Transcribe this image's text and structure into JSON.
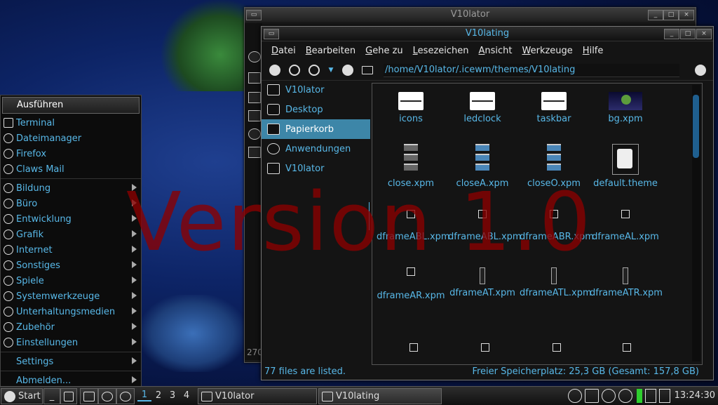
{
  "watermark": "Version 1.0",
  "back_window": {
    "title": "V10lator",
    "count_text": "270"
  },
  "window": {
    "title": "V10lating",
    "menu": [
      "Datei",
      "Bearbeiten",
      "Gehe zu",
      "Lesezeichen",
      "Ansicht",
      "Werkzeuge",
      "Hilfe"
    ],
    "toolbar": {
      "icons": [
        "back-icon",
        "forward-icon",
        "history-dropdown-icon",
        "up-icon",
        "home-folder-icon",
        "reload-icon"
      ],
      "path": "/home/V10lator/.icewm/themes/V10lating"
    },
    "sidebar": [
      {
        "label": "V10lator",
        "icon": "home-folder-icon",
        "selected": false
      },
      {
        "label": "Desktop",
        "icon": "desktop-icon",
        "selected": false
      },
      {
        "label": "Papierkorb",
        "icon": "trash-icon",
        "selected": true
      },
      {
        "label": "Anwendungen",
        "icon": "applications-icon",
        "selected": false
      },
      {
        "label": "V10lator",
        "icon": "drive-icon",
        "selected": false
      }
    ],
    "files": [
      {
        "name": "icons",
        "icon": "folder-icon"
      },
      {
        "name": "ledclock",
        "icon": "folder-icon"
      },
      {
        "name": "taskbar",
        "icon": "folder-icon"
      },
      {
        "name": "bg.xpm",
        "icon": "image-icon"
      },
      {
        "name": "close.xpm",
        "icon": "xpm-icon"
      },
      {
        "name": "closeA.xpm",
        "icon": "xpm-icon"
      },
      {
        "name": "closeO.xpm",
        "icon": "xpm-icon"
      },
      {
        "name": "default.theme",
        "icon": "theme-file-icon"
      },
      {
        "name": "dframeABL.xpm",
        "icon": "xpm-icon"
      },
      {
        "name": "dframeABL.xpm",
        "icon": "xpm-icon"
      },
      {
        "name": "dframeABR.xpm",
        "icon": "xpm-icon"
      },
      {
        "name": "dframeAL.xpm",
        "icon": "xpm-icon"
      },
      {
        "name": "dframeAR.xpm",
        "icon": "xpm-icon"
      },
      {
        "name": "dframeAT.xpm",
        "icon": "xpm-icon"
      },
      {
        "name": "dframeATL.xpm",
        "icon": "xpm-icon"
      },
      {
        "name": "dframeATR.xpm",
        "icon": "xpm-icon"
      }
    ],
    "status_left": "77 files are listed.",
    "status_right": "Freier Speicherplatz: 25,3 GB (Gesamt: 157,8 GB)"
  },
  "start_menu": {
    "header": "Ausführen",
    "apps": [
      {
        "label": "Terminal",
        "icon": "terminal-icon"
      },
      {
        "label": "Dateimanager",
        "icon": "file-manager-icon"
      },
      {
        "label": "Firefox",
        "icon": "firefox-icon"
      },
      {
        "label": "Claws Mail",
        "icon": "mail-icon"
      }
    ],
    "categories": [
      {
        "label": "Bildung",
        "icon": "education-icon"
      },
      {
        "label": "Büro",
        "icon": "office-icon"
      },
      {
        "label": "Entwicklung",
        "icon": "development-icon"
      },
      {
        "label": "Grafik",
        "icon": "graphics-icon"
      },
      {
        "label": "Internet",
        "icon": "internet-icon"
      },
      {
        "label": "Sonstiges",
        "icon": "other-icon"
      },
      {
        "label": "Spiele",
        "icon": "games-icon"
      },
      {
        "label": "Systemwerkzeuge",
        "icon": "system-tools-icon"
      },
      {
        "label": "Unterhaltungsmedien",
        "icon": "multimedia-icon"
      },
      {
        "label": "Zubehör",
        "icon": "accessories-icon"
      },
      {
        "label": "Einstellungen",
        "icon": "settings-icon"
      }
    ],
    "settings": "Settings",
    "logout": "Abmelden..."
  },
  "taskbar": {
    "start": "Start",
    "workspaces": [
      "1",
      "2",
      "3",
      "4"
    ],
    "active_workspace": "1",
    "tasks": [
      {
        "label": "V10lator",
        "active": false
      },
      {
        "label": "V10lating",
        "active": true
      }
    ],
    "clock": "13:24:30"
  }
}
